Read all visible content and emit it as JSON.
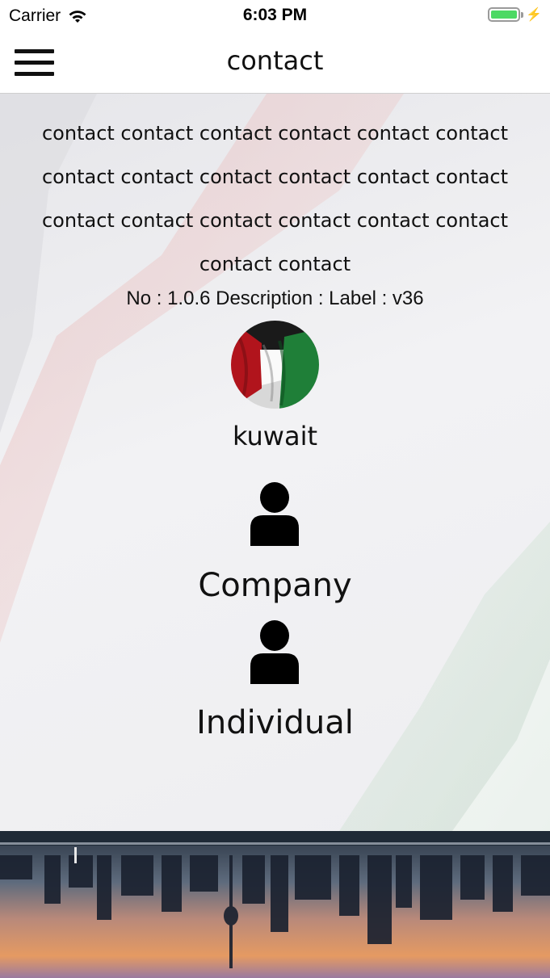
{
  "status_bar": {
    "carrier": "Carrier",
    "time": "6:03 PM",
    "icons": [
      "wifi-icon",
      "battery-icon",
      "charging-bolt-icon"
    ],
    "battery_color": "#4cd964"
  },
  "nav": {
    "title": "contact",
    "menu_icon": "hamburger-menu-icon"
  },
  "main": {
    "description": "contact contact contact contact contact contact contact contact contact contact contact contact contact contact contact contact contact contact contact contact",
    "version_line": "No : 1.0.6 Description :  Label : v36",
    "country": {
      "label": "kuwait",
      "icon": "kuwait-flag-avatar"
    },
    "options": [
      {
        "label": "Company",
        "icon": "person-icon"
      },
      {
        "label": "Individual",
        "icon": "person-icon"
      }
    ]
  },
  "colors": {
    "background": "#ececef",
    "text": "#111111",
    "flag_red": "#c8102e",
    "flag_green": "#007a3d",
    "flag_black": "#000000"
  }
}
